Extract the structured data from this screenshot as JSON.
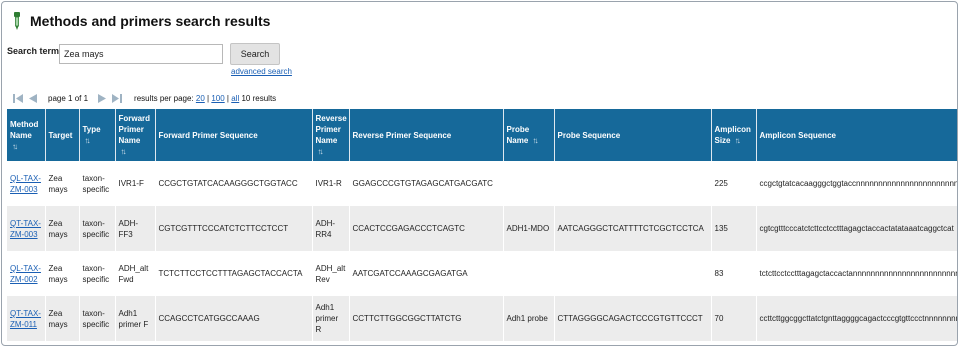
{
  "page": {
    "title": "Methods and primers search results"
  },
  "search": {
    "label": "Search term",
    "value": "Zea mays",
    "button_label": "Search",
    "advanced_link": "advanced search"
  },
  "pager": {
    "page_info": "page 1 of 1",
    "per_page_label": "results per page:",
    "options": [
      "20",
      "100",
      "all"
    ],
    "separator": "|",
    "result_count": "10 results"
  },
  "table": {
    "headers": {
      "method_name": "Method Name",
      "target": "Target",
      "type": "Type",
      "forward_primer_name": "Forward Primer Name",
      "forward_primer_sequence": "Forward Primer Sequence",
      "reverse_primer_name": "Reverse Primer Name",
      "reverse_primer_sequence": "Reverse Primer Sequence",
      "probe_name": "Probe Name",
      "probe_sequence": "Probe Sequence",
      "amplicon_size": "Amplicon Size",
      "amplicon_sequence": "Amplicon Sequence"
    },
    "sort_icon": "sort-arrows-icon",
    "rows": [
      {
        "method_name": "QL-TAX-ZM-003",
        "target": "Zea mays",
        "type": "taxon-specific",
        "forward_primer_name": "IVR1-F",
        "forward_primer_sequence": "CCGCTGTATCACAAGGGCTGGTACC",
        "reverse_primer_name": "IVR1-R",
        "reverse_primer_sequence": "GGAGCCCGTGTAGAGCATGACGATC",
        "probe_name": "",
        "probe_sequence": "",
        "amplicon_size": "225",
        "amplicon_sequence": "ccgctgtatcacaagggctggtaccnnnnnnnnnnnnnnnnnnnnnnnn"
      },
      {
        "method_name": "QT-TAX-ZM-003",
        "target": "Zea mays",
        "type": "taxon-specific",
        "forward_primer_name": "ADH-FF3",
        "forward_primer_sequence": "CGTCGTTTCCCATCTCTTCCTCCT",
        "reverse_primer_name": "ADH-RR4",
        "reverse_primer_sequence": "CCACTCCGAGACCCTCAGTC",
        "probe_name": "ADH1-MDO",
        "probe_sequence": "AATCAGGGCTCATTTTCTCGCTCCTCA",
        "amplicon_size": "135",
        "amplicon_sequence": "cgtcgtttcccatctcttcctcctttagagctaccactatataaatcaggctcat"
      },
      {
        "method_name": "QL-TAX-ZM-002",
        "target": "Zea mays",
        "type": "taxon-specific",
        "forward_primer_name": "ADH_alt Fwd",
        "forward_primer_sequence": "TCTCTTCCTCCTTTAGAGCTACCACTA",
        "reverse_primer_name": "ADH_alt Rev",
        "reverse_primer_sequence": "AATCGATCCAAAGCGAGATGA",
        "probe_name": "",
        "probe_sequence": "",
        "amplicon_size": "83",
        "amplicon_sequence": "tctcttcctcctttagagctaccactannnnnnnnnnnnnnnnnnnnnnnnn"
      },
      {
        "method_name": "QT-TAX-ZM-011",
        "target": "Zea mays",
        "type": "taxon-specific",
        "forward_primer_name": "Adh1 primer F",
        "forward_primer_sequence": "CCAGCCTCATGGCCAAAG",
        "reverse_primer_name": "Adh1 primer R",
        "reverse_primer_sequence": "CCTTCTTGGCGGCTTATCTG",
        "probe_name": "Adh1 probe",
        "probe_sequence": "CTTAGGGGCAGACTCCCGTGTTCCCT",
        "amplicon_size": "70",
        "amplicon_sequence": "ccttcttggcggcttatctgnttaggggcagactcccgtgttccctnnnnnnnnt"
      }
    ]
  },
  "colors": {
    "header_bg": "#16699a",
    "row_alt_bg": "#ececec",
    "link": "#1a5fb4"
  }
}
